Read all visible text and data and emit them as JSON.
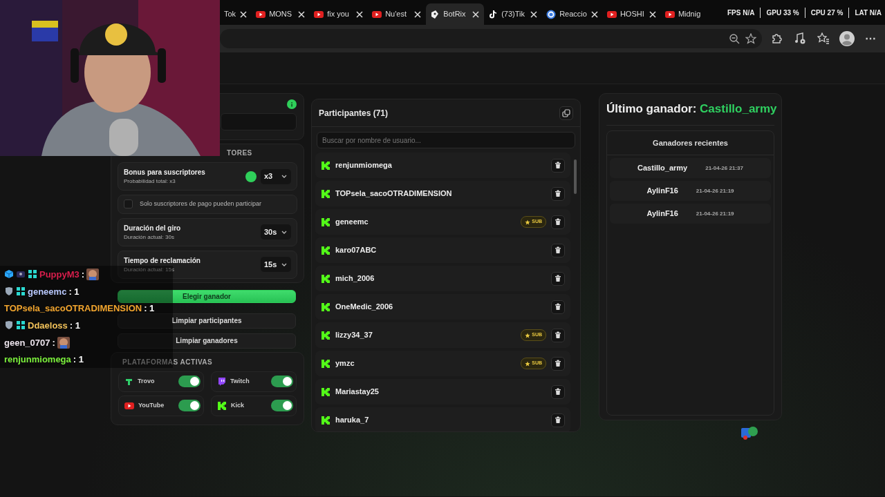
{
  "browser": {
    "tabs": [
      {
        "label": "Tok",
        "kind": "none",
        "closable": true,
        "selected": false
      },
      {
        "label": "MONS",
        "kind": "youtube",
        "closable": true,
        "selected": false
      },
      {
        "label": "fix you",
        "kind": "youtube",
        "closable": true,
        "selected": false
      },
      {
        "label": "Nu'est",
        "kind": "youtube",
        "closable": true,
        "selected": false
      },
      {
        "label": "BotRix",
        "kind": "botrix",
        "closable": true,
        "selected": true
      },
      {
        "label": "(73)Tik",
        "kind": "tiktok",
        "closable": true,
        "selected": false
      },
      {
        "label": "Reaccio",
        "kind": "circle",
        "closable": true,
        "selected": false
      },
      {
        "label": "HOSHI",
        "kind": "youtube",
        "closable": true,
        "selected": false
      },
      {
        "label": "Midnig",
        "kind": "youtube",
        "closable": false,
        "selected": false
      }
    ],
    "more": "⋯"
  },
  "stats": [
    "FPS N/A",
    "GPU 33 %",
    "CPU 27 %",
    "LAT N/A"
  ],
  "raffle": {
    "section_title": "TORES",
    "settings": [
      {
        "kind": "select",
        "title": "Bonus para suscriptores",
        "subtitle": "Probabilidad total: x3",
        "value": "x3",
        "info": true
      },
      {
        "kind": "checkbox",
        "label": "Solo suscriptores de pago pueden participar",
        "checked": false
      },
      {
        "kind": "select",
        "title": "Duración del giro",
        "subtitle": "Duración actual: 30s",
        "value": "30s",
        "info": false
      },
      {
        "kind": "select",
        "title": "Tiempo de reclamación",
        "subtitle": "Duración actual: 15s",
        "value": "15s",
        "info": false
      }
    ],
    "buttons": [
      {
        "label": "Elegir ganador",
        "kind": "primary"
      },
      {
        "label": "Limpiar participantes",
        "kind": "secondary"
      },
      {
        "label": "Limpiar ganadores",
        "kind": "secondary"
      }
    ],
    "platforms_title": "PLATAFORMAS ACTIVAS",
    "platforms": [
      {
        "name": "Trovo",
        "kind": "trovo",
        "on": true
      },
      {
        "name": "Twitch",
        "kind": "twitch",
        "on": true
      },
      {
        "name": "YouTube",
        "kind": "youtube",
        "on": true
      },
      {
        "name": "Kick",
        "kind": "kick",
        "on": true
      }
    ]
  },
  "participants": {
    "title": "Participantes (71)",
    "search_placeholder": "Buscar por nombre de usuario...",
    "items": [
      {
        "name": "renjunmiomega"
      },
      {
        "name": "TOPsela_sacoOTRADIMENSION"
      },
      {
        "name": "geneemc",
        "badge": "SUB"
      },
      {
        "name": "karo07ABC"
      },
      {
        "name": "mich_2006"
      },
      {
        "name": "OneMedic_2006"
      },
      {
        "name": "lizzy34_37",
        "badge": "SUB"
      },
      {
        "name": "ymzc",
        "badge": "SUB"
      },
      {
        "name": "Mariastay25"
      },
      {
        "name": "haruka_7"
      }
    ]
  },
  "winner": {
    "title": "Último ganador:",
    "name": "Castillo_army",
    "recent_title": "Ganadores recientes",
    "recent": [
      {
        "name": "Castillo_army",
        "time": "21-04-26 21:37"
      },
      {
        "name": "AylinF16",
        "time": "21-04-26 21:19"
      },
      {
        "name": "AylinF16",
        "time": "21-04-26 21:19"
      }
    ]
  },
  "chat": [
    {
      "name": "PuppyM3",
      "color": "#d81e4c",
      "kind": "emote",
      "text": ":",
      "prime": true,
      "moderator": false,
      "subscriber": true
    },
    {
      "name": "geneemc",
      "color": "#b9c9ff",
      "kind": "text",
      "text": ": 1",
      "prime": false,
      "moderator": true,
      "subscriber": true
    },
    {
      "name": "TOPsela_sacoOTRADIMENSION",
      "color": "#f2a52e",
      "kind": "text",
      "text": ": 1",
      "prime": false,
      "moderator": false,
      "subscriber": false
    },
    {
      "name": "Ddaeloss",
      "color": "#f2c25a",
      "kind": "text",
      "text": ": 1",
      "prime": false,
      "moderator": true,
      "subscriber": true
    },
    {
      "name": "geen_0707",
      "color": "#ece4ec",
      "kind": "emote",
      "text": ":",
      "prime": false,
      "moderator": false,
      "subscriber": false
    },
    {
      "name": "renjunmiomega",
      "color": "#7cf23c",
      "kind": "text",
      "text": ": 1",
      "prime": false,
      "moderator": false,
      "subscriber": false
    }
  ]
}
